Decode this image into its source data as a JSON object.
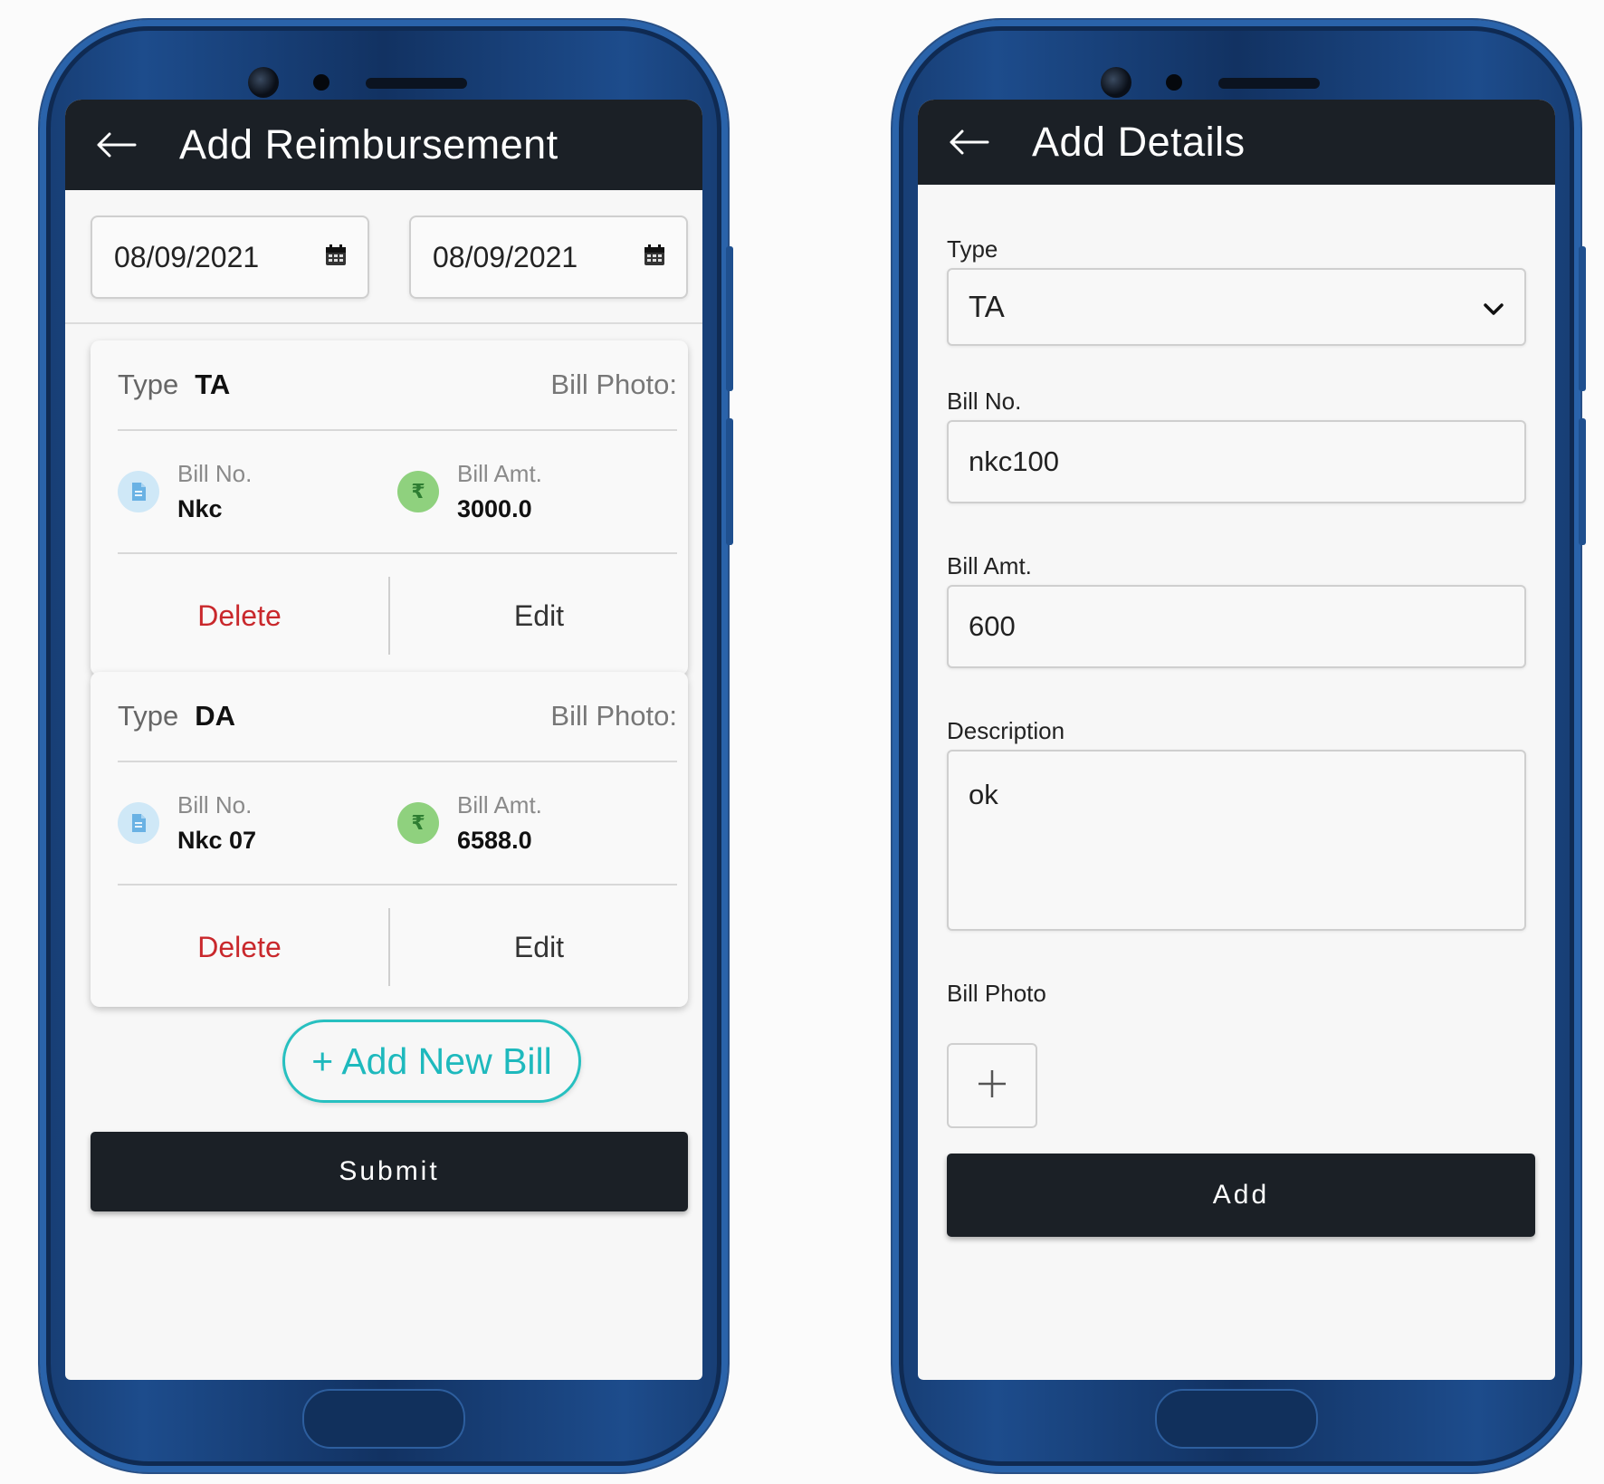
{
  "left_screen": {
    "title": "Add Reimbursement",
    "from_date": "08/09/2021",
    "to_date": "08/09/2021",
    "bills": [
      {
        "type_label": "Type",
        "type_value": "TA",
        "photo_label": "Bill Photo:",
        "bill_no_label": "Bill No.",
        "bill_no": "Nkc",
        "bill_amt_label": "Bill Amt.",
        "bill_amt": "3000.0",
        "delete_label": "Delete",
        "edit_label": "Edit"
      },
      {
        "type_label": "Type",
        "type_value": "DA",
        "photo_label": "Bill Photo:",
        "bill_no_label": "Bill No.",
        "bill_no": "Nkc 07",
        "bill_amt_label": "Bill Amt.",
        "bill_amt": "6588.0",
        "delete_label": "Delete",
        "edit_label": "Edit"
      }
    ],
    "add_bill_label": "+ Add New Bill",
    "submit_label": "Submit"
  },
  "right_screen": {
    "title": "Add Details",
    "type_label": "Type",
    "type_value": "TA",
    "bill_no_label": "Bill No.",
    "bill_no_value": "nkc100",
    "bill_amt_label": "Bill Amt.",
    "bill_amt_value": "600",
    "description_label": "Description",
    "description_value": "ok",
    "bill_photo_label": "Bill Photo",
    "add_label": "Add"
  },
  "icons": {
    "back": "arrow-left-icon",
    "calendar": "calendar-icon",
    "bill_no": "document-icon",
    "bill_amt": "rupee-icon",
    "rupee_glyph": "₹",
    "dropdown": "chevron-down-icon",
    "add_photo": "plus-icon"
  },
  "colors": {
    "app_bar": "#1b2026",
    "delete": "#c9282c",
    "accent_teal": "#1eb9bd",
    "phone_body": "#173d73"
  }
}
